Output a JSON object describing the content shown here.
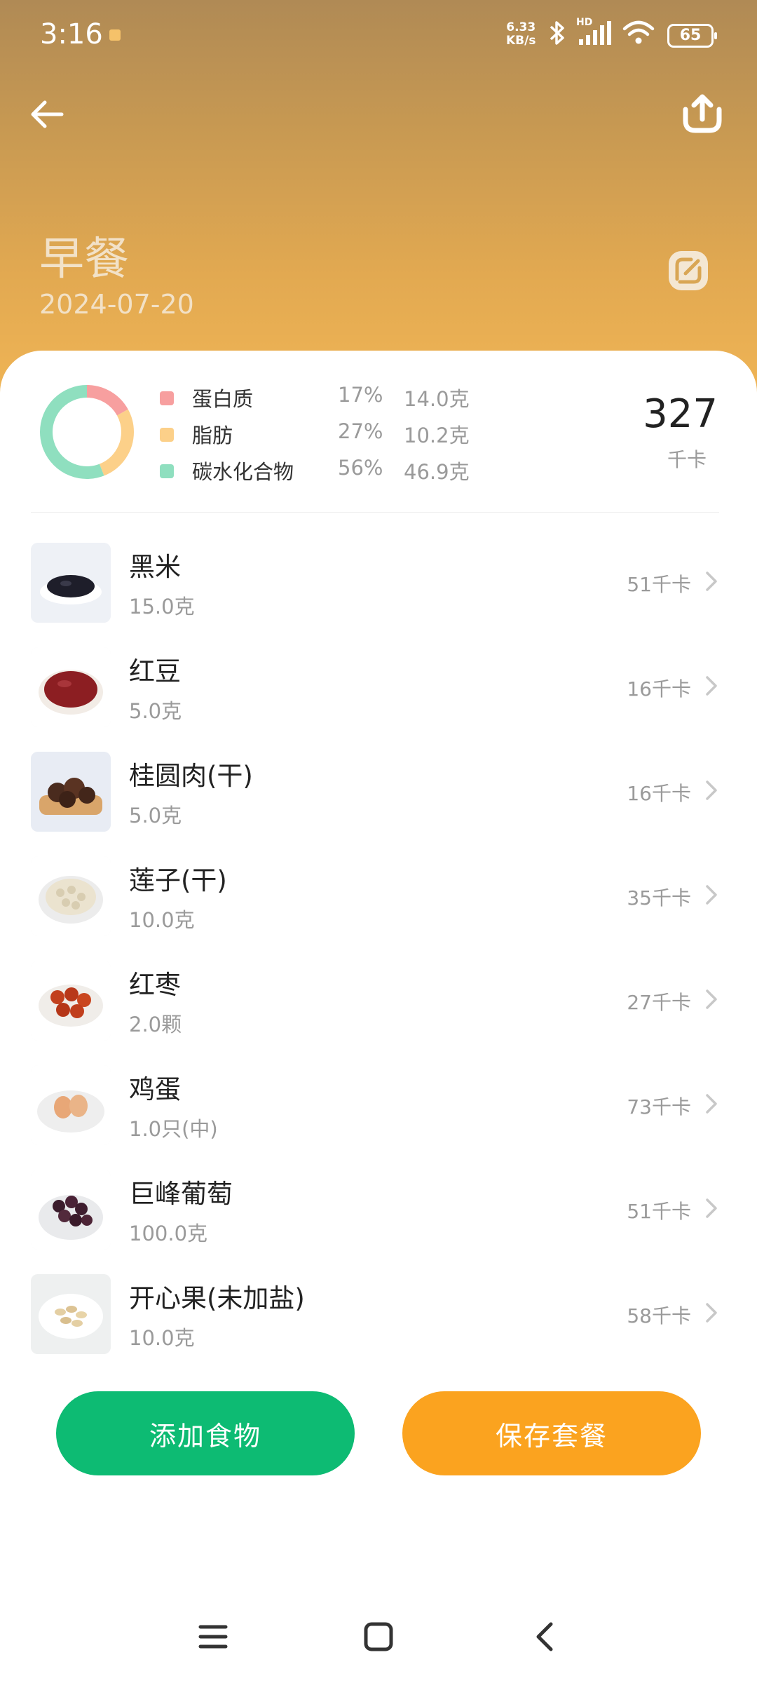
{
  "status_bar": {
    "time": "3:16",
    "net_speed_top": "6.33",
    "net_speed_bottom": "KB/s",
    "hd_label": "HD",
    "battery": "65"
  },
  "header": {
    "title": "早餐",
    "date": "2024-07-20"
  },
  "nutrition": {
    "legend": [
      {
        "name": "蛋白质",
        "percent": "17%",
        "grams": "14.0克",
        "color": "#f79f9f"
      },
      {
        "name": "脂肪",
        "percent": "27%",
        "grams": "10.2克",
        "color": "#fcd089"
      },
      {
        "name": "碳水化合物",
        "percent": "56%",
        "grams": "46.9克",
        "color": "#8fdfbf"
      }
    ],
    "donut_fractions": [
      0.17,
      0.27,
      0.56
    ],
    "total_kcal": "327",
    "kcal_unit": "千卡"
  },
  "foods": [
    {
      "name": "黑米",
      "amount": "15.0克",
      "kcal": "51千卡",
      "icon": "black-rice-icon"
    },
    {
      "name": "红豆",
      "amount": "5.0克",
      "kcal": "16千卡",
      "icon": "red-bean-icon"
    },
    {
      "name": "桂圆肉(干)",
      "amount": "5.0克",
      "kcal": "16千卡",
      "icon": "longan-icon"
    },
    {
      "name": "莲子(干)",
      "amount": "10.0克",
      "kcal": "35千卡",
      "icon": "lotus-seed-icon"
    },
    {
      "name": "红枣",
      "amount": "2.0颗",
      "kcal": "27千卡",
      "icon": "red-date-icon"
    },
    {
      "name": "鸡蛋",
      "amount": "1.0只(中)",
      "kcal": "73千卡",
      "icon": "egg-icon"
    },
    {
      "name": "巨峰葡萄",
      "amount": "100.0克",
      "kcal": "51千卡",
      "icon": "grape-icon"
    },
    {
      "name": "开心果(未加盐)",
      "amount": "10.0克",
      "kcal": "58千卡",
      "icon": "pistachio-icon"
    }
  ],
  "actions": {
    "add_food": "添加食物",
    "save_meal": "保存套餐"
  },
  "colors": {
    "add_button": "#0dbb73",
    "save_button": "#fba31f",
    "header_top": "#b08a55",
    "header_bottom": "#efb455"
  }
}
